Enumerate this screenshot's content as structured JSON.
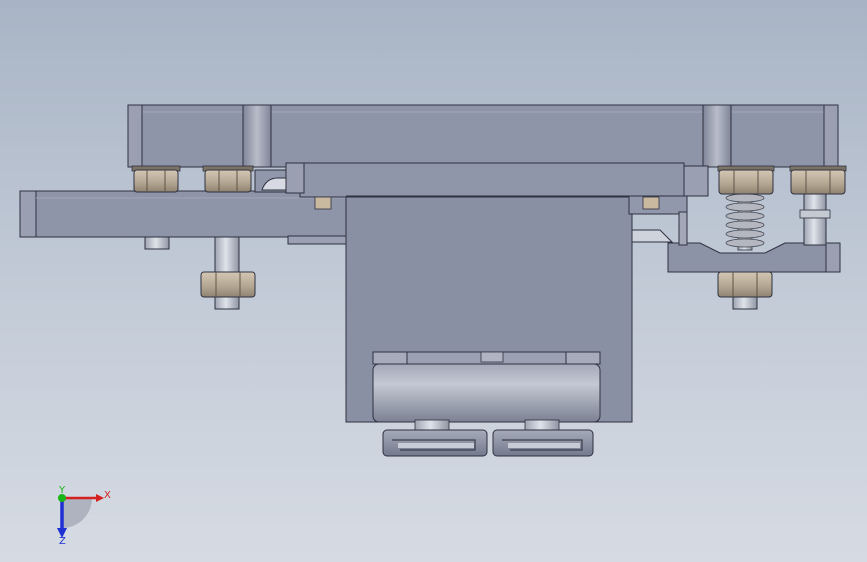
{
  "viewport": {
    "background_top": "#a8b4c5",
    "background_bottom": "#d6dbe3"
  },
  "model": {
    "body_color": "#8d93a6",
    "body_light": "#9aa0b3",
    "edge_color": "#2e3140",
    "nut_color": "#b9ab97",
    "nut_shadow": "#8e8272",
    "bolt_color": "#c3c8d3",
    "spring_color": "#a9acb4"
  },
  "triad": {
    "x_label": "X",
    "y_label": "Y",
    "z_label": "Z",
    "x_color": "#d42020",
    "y_color": "#18b418",
    "z_color": "#1e2fd4"
  }
}
